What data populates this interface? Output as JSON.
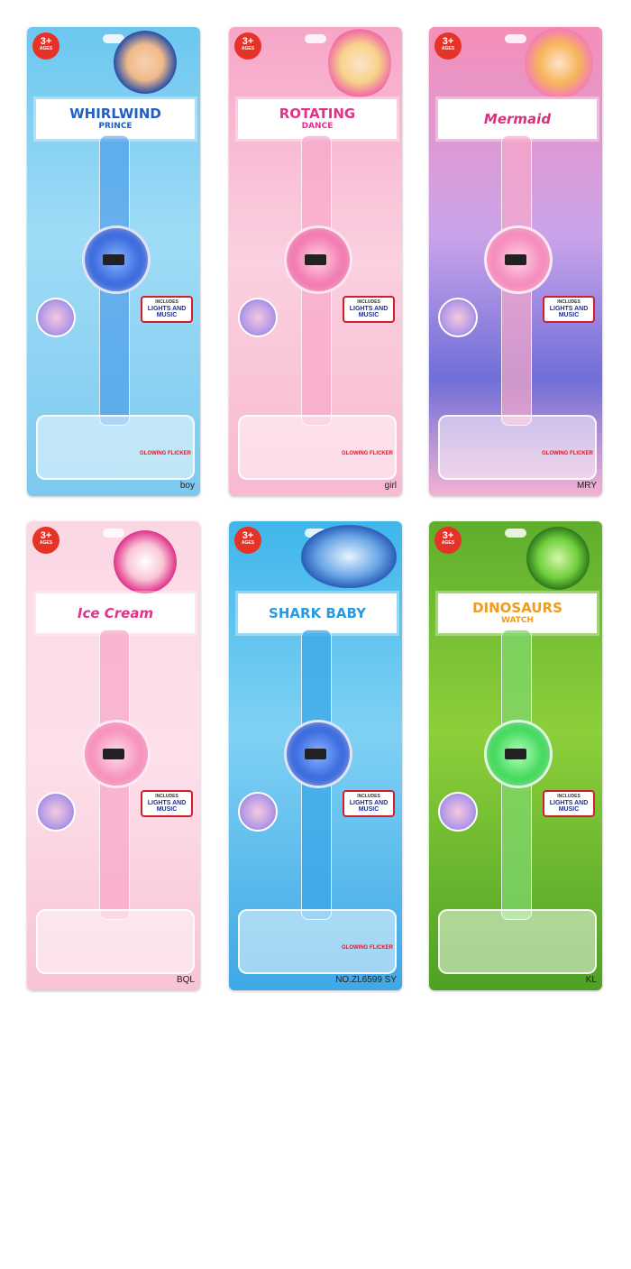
{
  "cards": [
    {
      "badge_num": "3+",
      "badge_ages": "AGES",
      "title": "WHIRLWIND",
      "subtitle": "PRINCE",
      "lights_small": "INCLUDES",
      "lights": "LIGHTS AND MUSIC",
      "glow": "GLOWING FLICKER",
      "code": "boy",
      "title_color": "#1f5fc7",
      "face_color": "#2a5bd8",
      "strap_color": "#3a8ee6",
      "accent": "#3b2a7a"
    },
    {
      "badge_num": "3+",
      "badge_ages": "AGES",
      "title": "ROTATING",
      "subtitle": "DANCE",
      "lights_small": "INCLUDES",
      "lights": "LIGHTS AND MUSIC",
      "glow": "GLOWING FLICKER",
      "code": "girl",
      "title_color": "#e0338a",
      "face_color": "#f06aa5",
      "strap_color": "#f7a8c9",
      "accent": "#d13b7f"
    },
    {
      "badge_num": "3+",
      "badge_ages": "AGES",
      "title": "Mermaid",
      "subtitle": "",
      "lights_small": "INCLUDES",
      "lights": "LIGHTS AND MUSIC",
      "glow": "GLOWING FLICKER",
      "code": "MRY",
      "title_color": "#d8327d",
      "face_color": "#f47db4",
      "strap_color": "#f7a8c9",
      "accent": "#7c4fd1"
    },
    {
      "badge_num": "3+",
      "badge_ages": "AGES",
      "title": "Ice Cream",
      "subtitle": "",
      "lights_small": "INCLUDES",
      "lights": "LIGHTS AND MUSIC",
      "glow": "",
      "code": "BQL",
      "title_color": "#e0338a",
      "face_color": "#f583b3",
      "strap_color": "#f7a8c9",
      "accent": "#e0338a"
    },
    {
      "badge_num": "3+",
      "badge_ages": "AGES",
      "title": "SHARK BABY",
      "subtitle": "",
      "lights_small": "INCLUDES",
      "lights": "LIGHTS AND MUSIC",
      "glow": "GLOWING FLICKER",
      "code": "NO.ZL6599 SY",
      "title_color": "#2a9ae0",
      "face_color": "#2a5bd8",
      "strap_color": "#3aa6e6",
      "accent": "#1c3d8e"
    },
    {
      "badge_num": "3+",
      "badge_ages": "AGES",
      "title": "DINOSAURS",
      "subtitle": "WATCH",
      "lights_small": "INCLUDES",
      "lights": "LIGHTS AND MUSIC",
      "glow": "",
      "code": "KL",
      "title_color": "#f29a1a",
      "face_color": "#2fd24a",
      "strap_color": "#7fd66b",
      "accent": "#2f7a1c"
    }
  ]
}
